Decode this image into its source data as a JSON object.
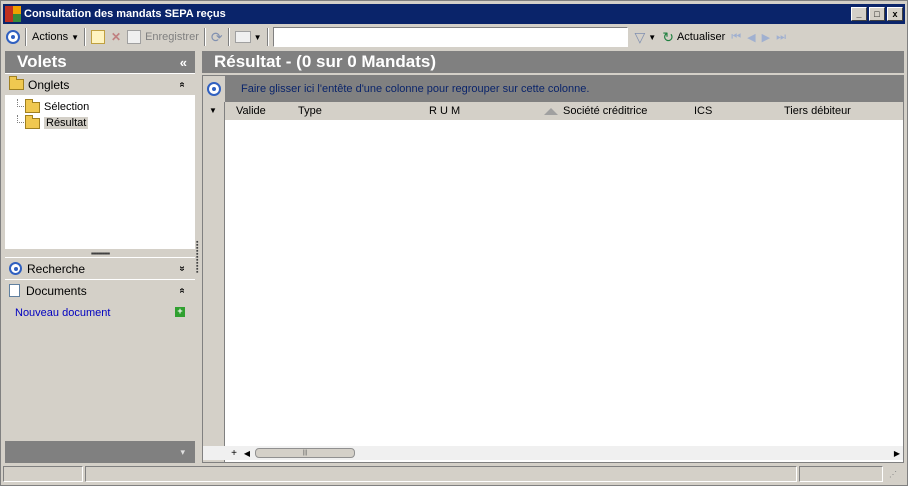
{
  "window": {
    "title": "Consultation des mandats SEPA reçus",
    "controls": {
      "minimize": "_",
      "maximize": "□",
      "close": "x"
    }
  },
  "toolbar": {
    "actions_label": "Actions",
    "save_label": "Enregistrer",
    "search_value": "",
    "refresh_label": "Actualiser"
  },
  "left": {
    "header": "Volets",
    "collapse_glyph": "«",
    "onglets": {
      "label": "Onglets",
      "chevron": "«",
      "items": [
        {
          "label": "Sélection",
          "selected": false
        },
        {
          "label": "Résultat",
          "selected": true
        }
      ]
    },
    "recherche": {
      "label": "Recherche",
      "chevron": "»"
    },
    "documents": {
      "label": "Documents",
      "chevron": "«",
      "new_doc": "Nouveau document"
    },
    "footer_glyph": "▾"
  },
  "main": {
    "header": "Résultat - (0 sur 0 Mandats)",
    "group_hint": "Faire glisser ici l'entête d'une colonne pour regrouper sur cette colonne.",
    "columns": [
      "Valide",
      "Type",
      "R U M",
      "Société créditrice",
      "ICS",
      "Tiers débiteur"
    ]
  }
}
